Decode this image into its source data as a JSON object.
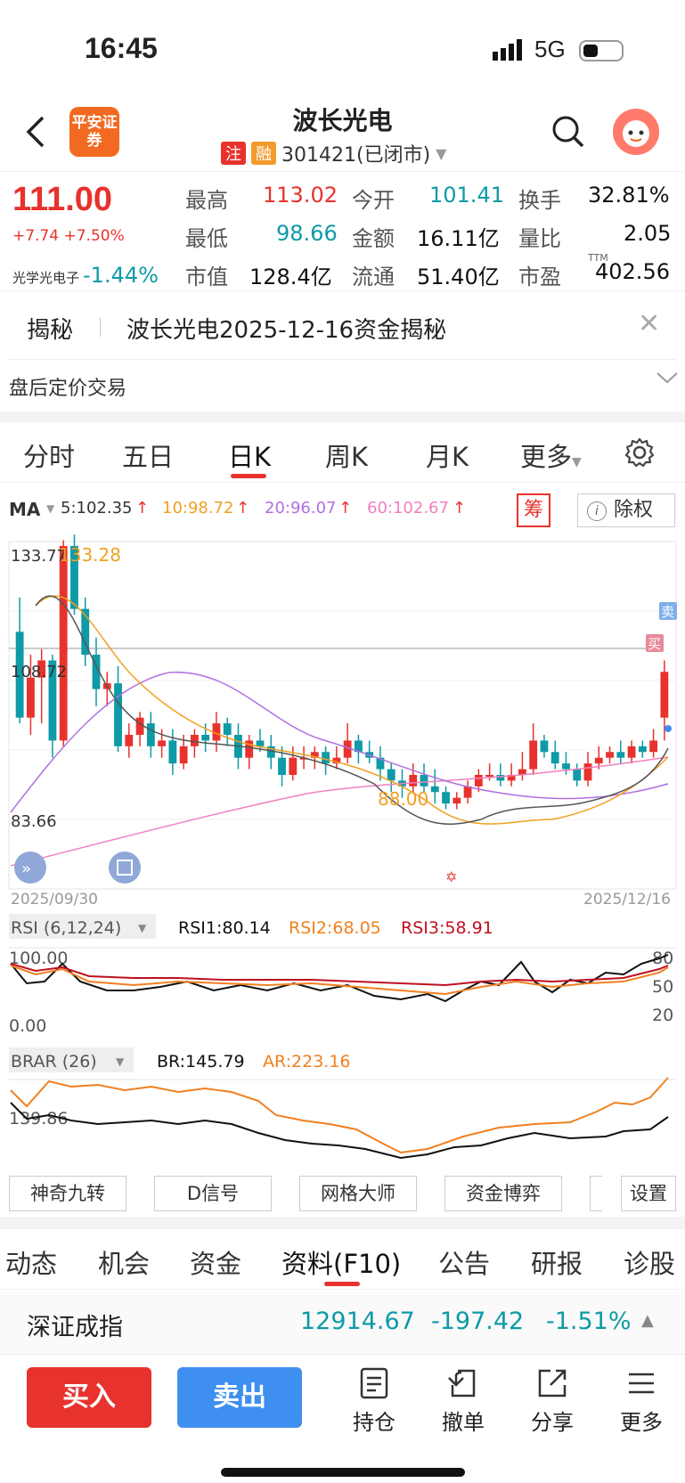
{
  "status": {
    "time": "16:45",
    "network": "5G"
  },
  "header": {
    "logo_text": "平安证券",
    "title": "波长光电",
    "tag_zhu": "注",
    "tag_rong": "融",
    "code": "301421(已闭市)"
  },
  "quote": {
    "price": "111.00",
    "change": "+7.74 +7.50%",
    "sector_name": "光学光电子",
    "sector_change": "-1.44%",
    "items": [
      {
        "label": "最高",
        "value": "113.02"
      },
      {
        "label": "今开",
        "value": "101.41"
      },
      {
        "label": "换手",
        "value": "32.81%"
      },
      {
        "label": "最低",
        "value": "98.66"
      },
      {
        "label": "金额",
        "value": "16.11亿"
      },
      {
        "label": "量比",
        "value": "2.05"
      },
      {
        "label": "市值",
        "value": "128.4亿"
      },
      {
        "label": "流通",
        "value": "51.40亿"
      },
      {
        "label": "市盈",
        "value": "402.56"
      }
    ],
    "ttm": "TTM"
  },
  "reveal": {
    "label": "揭秘",
    "text": "波长光电2025-12-16资金揭秘"
  },
  "after_hours": "盘后定价交易",
  "ktabs": [
    "分时",
    "五日",
    "日K",
    "周K",
    "月K",
    "更多"
  ],
  "ma": {
    "label": "MA",
    "ma5": "5:102.35",
    "ma10": "10:98.72",
    "ma20": "20:96.07",
    "ma60": "60:102.67",
    "chou": "筹",
    "chuquan": "除权"
  },
  "kline": {
    "y_top": "133.77",
    "y_mid": "108.72",
    "y_bot": "83.66",
    "high_label": "133.28",
    "low_label": "88.00",
    "date_start": "2025/09/30",
    "date_end": "2025/12/16",
    "sell_mark": "卖",
    "buy_mark": "买"
  },
  "rsi": {
    "title": "RSI (6,12,24)",
    "rsi1": "RSI1:80.14",
    "rsi2": "RSI2:68.05",
    "rsi3": "RSI3:58.91",
    "y_top": "100.00",
    "y_bot": "0.00",
    "r80": "80",
    "r50": "50",
    "r20": "20"
  },
  "brar": {
    "title": "BRAR (26)",
    "br": "BR:145.79",
    "ar": "AR:223.16",
    "y_mid": "139.86"
  },
  "tools": [
    "神奇九转",
    "D信号",
    "网格大师",
    "资金博弈",
    "设置"
  ],
  "btabs": [
    "动态",
    "机会",
    "资金",
    "资料(F10)",
    "公告",
    "研报",
    "诊股"
  ],
  "index": {
    "name": "深证成指",
    "value": "12914.67",
    "change": "-197.42",
    "pct": "-1.51%"
  },
  "bottom": {
    "buy": "买入",
    "sell": "卖出",
    "hold": "持仓",
    "cancel": "撤单",
    "share": "分享",
    "more": "更多"
  },
  "colors": {
    "up": "#e8322d",
    "down": "#0e9aa7",
    "ma5": "#555555",
    "ma10": "#f0a020",
    "ma20": "#b070e0",
    "ma60": "#f080c0"
  },
  "chart_data": {
    "type": "candlestick",
    "date_start": "2025/09/30",
    "date_end": "2025/12/16",
    "ylim": [
      83.66,
      133.77
    ],
    "candles": [
      [
        118,
        103,
        124,
        102
      ],
      [
        103,
        110,
        114,
        100
      ],
      [
        110,
        113,
        115,
        102
      ],
      [
        113,
        99,
        114,
        96
      ],
      [
        99,
        133,
        134,
        98
      ],
      [
        133,
        122,
        135,
        121
      ],
      [
        122,
        114,
        124,
        112
      ],
      [
        114,
        108,
        117,
        105
      ],
      [
        108,
        109,
        111,
        105
      ],
      [
        109,
        98,
        112,
        97
      ],
      [
        98,
        100,
        102,
        96
      ],
      [
        100,
        103,
        104,
        98
      ],
      [
        102,
        98,
        104,
        96
      ],
      [
        98,
        99,
        101,
        96
      ],
      [
        99,
        95,
        101,
        93
      ],
      [
        95,
        98,
        100,
        94
      ],
      [
        98,
        100,
        101,
        96
      ],
      [
        100,
        99,
        102,
        97
      ],
      [
        99,
        102,
        104,
        97
      ],
      [
        102,
        100,
        103,
        98
      ],
      [
        100,
        96,
        102,
        94
      ],
      [
        96,
        99,
        100,
        94
      ],
      [
        99,
        98,
        101,
        97
      ],
      [
        98,
        96,
        100,
        94
      ],
      [
        96,
        93,
        98,
        91
      ],
      [
        93,
        96,
        98,
        92
      ],
      [
        96,
        96,
        98,
        94
      ],
      [
        96,
        97,
        98,
        94
      ],
      [
        97,
        95,
        98,
        93
      ],
      [
        95,
        96,
        98,
        94
      ],
      [
        96,
        99,
        102,
        95
      ],
      [
        99,
        97,
        100,
        95
      ],
      [
        97,
        96,
        99,
        95
      ],
      [
        96,
        94,
        98,
        92
      ],
      [
        94,
        92,
        95,
        90
      ],
      [
        92,
        91,
        94,
        89
      ],
      [
        91,
        93,
        95,
        90
      ],
      [
        93,
        91,
        95,
        90
      ],
      [
        91,
        90,
        94,
        88
      ],
      [
        90,
        88,
        91,
        87
      ],
      [
        88,
        89,
        90,
        87
      ],
      [
        89,
        91,
        92,
        88
      ],
      [
        91,
        93,
        94,
        90
      ],
      [
        93,
        93,
        95,
        92
      ],
      [
        93,
        92,
        95,
        91
      ],
      [
        92,
        93,
        95,
        91
      ],
      [
        93,
        94,
        97,
        92
      ],
      [
        94,
        99,
        102,
        93
      ],
      [
        99,
        97,
        100,
        96
      ],
      [
        97,
        95,
        99,
        94
      ],
      [
        95,
        94,
        97,
        93
      ],
      [
        94,
        92,
        95,
        91
      ],
      [
        92,
        95,
        97,
        91
      ],
      [
        95,
        96,
        98,
        94
      ],
      [
        96,
        97,
        98,
        95
      ],
      [
        97,
        96,
        99,
        95
      ],
      [
        96,
        98,
        99,
        95
      ],
      [
        98,
        97,
        99,
        96
      ],
      [
        97,
        99,
        101,
        96
      ],
      [
        103,
        111,
        113,
        99
      ]
    ]
  }
}
